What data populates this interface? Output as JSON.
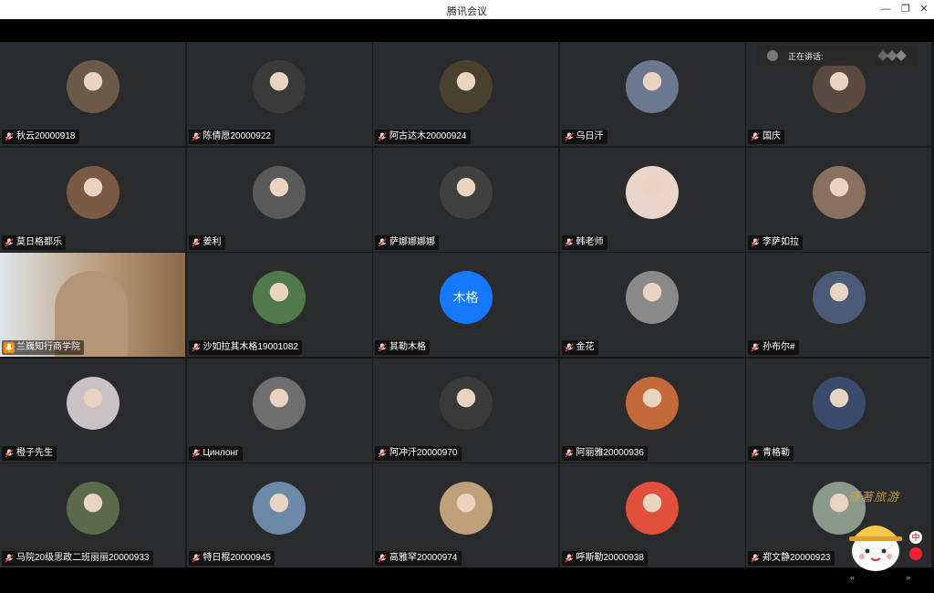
{
  "window": {
    "title": "腾讯会议"
  },
  "speaking": {
    "label": "正在讲话:"
  },
  "participants": [
    {
      "name": "秋云20000918",
      "avatar_color": "#6b5a4a"
    },
    {
      "name": "陈倩愿20000922",
      "avatar_color": "#3a3a3a"
    },
    {
      "name": "阿古达木20000924",
      "avatar_color": "#4a4030"
    },
    {
      "name": "乌日汗",
      "avatar_color": "#6a7890"
    },
    {
      "name": "国庆",
      "avatar_color": "#5a4a40"
    },
    {
      "name": "莫日格都乐",
      "avatar_color": "#7a5a40"
    },
    {
      "name": "姜利",
      "avatar_color": "#5a5a5a"
    },
    {
      "name": "萨娜娜娜娜",
      "avatar_color": "#404040"
    },
    {
      "name": "韩老师",
      "avatar_color": "#e9d5c9"
    },
    {
      "name": "李萨如拉",
      "avatar_color": "#8a7060"
    },
    {
      "name": "兰巍知行商学院",
      "avatar_color": "#b59577",
      "host": true
    },
    {
      "name": "沙如拉其木格19001082",
      "avatar_color": "#4f7a4a"
    },
    {
      "name": "其勒木格",
      "avatar_letter": "木格",
      "avatar_color": "#1677ff"
    },
    {
      "name": "金花",
      "avatar_color": "#8a8a8a"
    },
    {
      "name": "孙布尔#",
      "avatar_color": "#4a5a78"
    },
    {
      "name": "橙子先生",
      "avatar_color": "#c9c2c5"
    },
    {
      "name": "Цинлонг",
      "avatar_color": "#6e6e6e"
    },
    {
      "name": "阿冲汗20000970",
      "avatar_color": "#3a3a3a"
    },
    {
      "name": "阿丽雅20000936",
      "avatar_color": "#c46a3a"
    },
    {
      "name": "青格勒",
      "avatar_color": "#3a4a6a"
    },
    {
      "name": "马院20级思政二班丽丽20000933",
      "avatar_color": "#5a6a4a"
    },
    {
      "name": "特日棍20000945",
      "avatar_color": "#6a8aa8"
    },
    {
      "name": "高雅罕20000974",
      "avatar_color": "#c0a07a"
    },
    {
      "name": "呼斯勒20000938",
      "avatar_color": "#e0503a"
    },
    {
      "name": "郑文静20000923",
      "avatar_color": "#8a9a8a"
    }
  ],
  "watermark": {
    "text": "逐著旅游"
  },
  "badge": {
    "lang": "中"
  },
  "nav": {
    "left": "«",
    "right": "»"
  }
}
